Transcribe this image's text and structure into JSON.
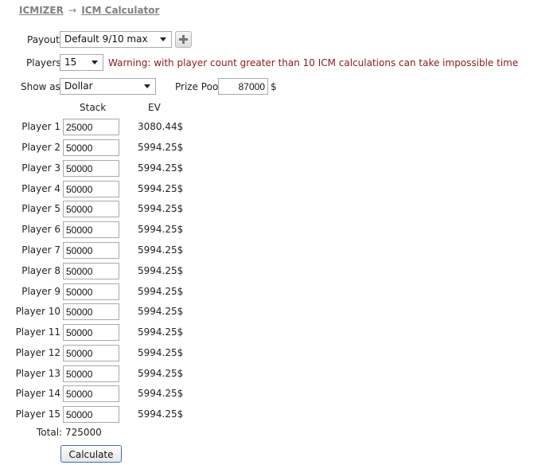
{
  "breadcrumb": {
    "home": "ICMIZER",
    "separator": "→",
    "current": "ICM Calculator"
  },
  "payout": {
    "label": "Payout",
    "selected": "Default 9/10 max",
    "add_icon": "plus-icon"
  },
  "players": {
    "label": "Players",
    "selected": "15",
    "warning": "Warning: with player count greater than 10 ICM calculations can take impossible time"
  },
  "show_as": {
    "label": "Show as",
    "selected": "Dollar"
  },
  "prize_pool": {
    "label": "Prize Pool",
    "value": "87000",
    "unit": "$"
  },
  "table": {
    "stack_header": "Stack",
    "ev_header": "EV",
    "rows": [
      {
        "name": "Player 1",
        "stack": "25000",
        "ev": "3080.44$"
      },
      {
        "name": "Player 2",
        "stack": "50000",
        "ev": "5994.25$"
      },
      {
        "name": "Player 3",
        "stack": "50000",
        "ev": "5994.25$"
      },
      {
        "name": "Player 4",
        "stack": "50000",
        "ev": "5994.25$"
      },
      {
        "name": "Player 5",
        "stack": "50000",
        "ev": "5994.25$"
      },
      {
        "name": "Player 6",
        "stack": "50000",
        "ev": "5994.25$"
      },
      {
        "name": "Player 7",
        "stack": "50000",
        "ev": "5994.25$"
      },
      {
        "name": "Player 8",
        "stack": "50000",
        "ev": "5994.25$"
      },
      {
        "name": "Player 9",
        "stack": "50000",
        "ev": "5994.25$"
      },
      {
        "name": "Player 10",
        "stack": "50000",
        "ev": "5994.25$"
      },
      {
        "name": "Player 11",
        "stack": "50000",
        "ev": "5994.25$"
      },
      {
        "name": "Player 12",
        "stack": "50000",
        "ev": "5994.25$"
      },
      {
        "name": "Player 13",
        "stack": "50000",
        "ev": "5994.25$"
      },
      {
        "name": "Player 14",
        "stack": "50000",
        "ev": "5994.25$"
      },
      {
        "name": "Player 15",
        "stack": "50000",
        "ev": "5994.25$"
      }
    ],
    "total_label": "Total:",
    "total_value": "725000"
  },
  "calculate_label": "Calculate",
  "colors": {
    "warning": "#8b1a1a",
    "breadcrumb": "#808080",
    "button_border": "#3b6fb6"
  }
}
